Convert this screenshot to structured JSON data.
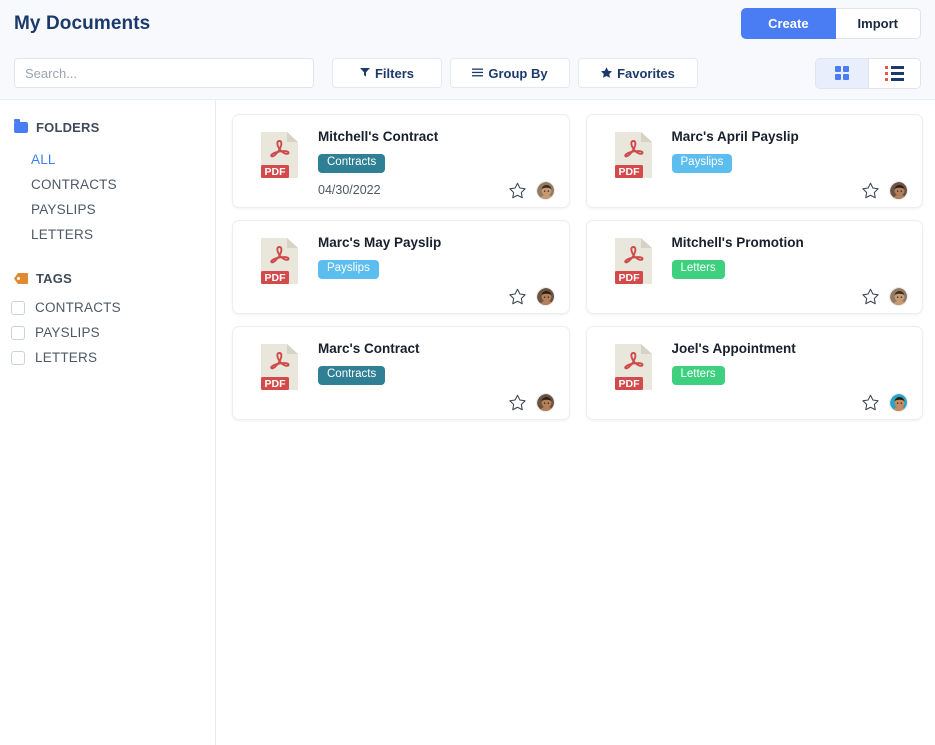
{
  "header": {
    "title": "My Documents",
    "create_label": "Create",
    "import_label": "Import"
  },
  "toolbar": {
    "search_placeholder": "Search...",
    "search_value": "",
    "filters_label": "Filters",
    "filters_icon": "funnel-icon",
    "groupby_label": "Group By",
    "groupby_icon": "list-lines-icon",
    "favorites_label": "Favorites",
    "favorites_icon": "star-filled-icon",
    "view_grid_icon": "grid-view-icon",
    "view_list_icon": "list-view-icon",
    "active_view": "grid"
  },
  "sidebar": {
    "folders_heading": "FOLDERS",
    "folders_icon": "folder-icon",
    "folders": [
      {
        "label": "ALL",
        "active": true
      },
      {
        "label": "CONTRACTS",
        "active": false
      },
      {
        "label": "PAYSLIPS",
        "active": false
      },
      {
        "label": "LETTERS",
        "active": false
      }
    ],
    "tags_heading": "TAGS",
    "tags_icon": "tag-icon",
    "tags": [
      {
        "label": "CONTRACTS",
        "checked": false
      },
      {
        "label": "PAYSLIPS",
        "checked": false
      },
      {
        "label": "LETTERS",
        "checked": false
      }
    ]
  },
  "colors": {
    "accent": "#4a7cf3",
    "title_navy": "#1b3a6b",
    "badge_contracts": "#2f7f95",
    "badge_payslips": "#5cbdef",
    "badge_letters": "#3dd17f",
    "pdf_red": "#d34a4a",
    "header_bg": "#f8f9fc"
  },
  "documents": [
    {
      "name": "Mitchell's Contract",
      "tag": "Contracts",
      "tag_color": "#2f7f95",
      "date": "04/30/2022",
      "file_type": "PDF",
      "file_icon": "pdf-file-icon",
      "favorite": false,
      "star_icon": "star-outline-icon",
      "avatar_name": "avatar-mitchell",
      "avatar_bg": "#8f7a63",
      "avatar_skin": "#c89a74",
      "avatar_hair": "#3a2b20"
    },
    {
      "name": "Marc's April Payslip",
      "tag": "Payslips",
      "tag_color": "#5cbdef",
      "date": "",
      "file_type": "PDF",
      "file_icon": "pdf-file-icon",
      "favorite": false,
      "star_icon": "star-outline-icon",
      "avatar_name": "avatar-marc",
      "avatar_bg": "#6b5344",
      "avatar_skin": "#b4805c",
      "avatar_hair": "#2e1f16"
    },
    {
      "name": "Marc's May Payslip",
      "tag": "Payslips",
      "tag_color": "#5cbdef",
      "date": "",
      "file_type": "PDF",
      "file_icon": "pdf-file-icon",
      "favorite": false,
      "star_icon": "star-outline-icon",
      "avatar_name": "avatar-marc",
      "avatar_bg": "#6b5344",
      "avatar_skin": "#b4805c",
      "avatar_hair": "#2e1f16"
    },
    {
      "name": "Mitchell's Promotion",
      "tag": "Letters",
      "tag_color": "#3dd17f",
      "date": "",
      "file_type": "PDF",
      "file_icon": "pdf-file-icon",
      "favorite": false,
      "star_icon": "star-outline-icon",
      "avatar_name": "avatar-mitchell",
      "avatar_bg": "#8f7a63",
      "avatar_skin": "#c89a74",
      "avatar_hair": "#3a2b20"
    },
    {
      "name": "Marc's Contract",
      "tag": "Contracts",
      "tag_color": "#2f7f95",
      "date": "",
      "file_type": "PDF",
      "file_icon": "pdf-file-icon",
      "favorite": false,
      "star_icon": "star-outline-icon",
      "avatar_name": "avatar-marc",
      "avatar_bg": "#6b5344",
      "avatar_skin": "#b4805c",
      "avatar_hair": "#2e1f16"
    },
    {
      "name": "Joel's Appointment",
      "tag": "Letters",
      "tag_color": "#3dd17f",
      "date": "",
      "file_type": "PDF",
      "file_icon": "pdf-file-icon",
      "favorite": false,
      "star_icon": "star-outline-icon",
      "avatar_name": "avatar-joel",
      "avatar_bg": "#2aa3c4",
      "avatar_skin": "#c98a60",
      "avatar_hair": "#241a12"
    }
  ]
}
